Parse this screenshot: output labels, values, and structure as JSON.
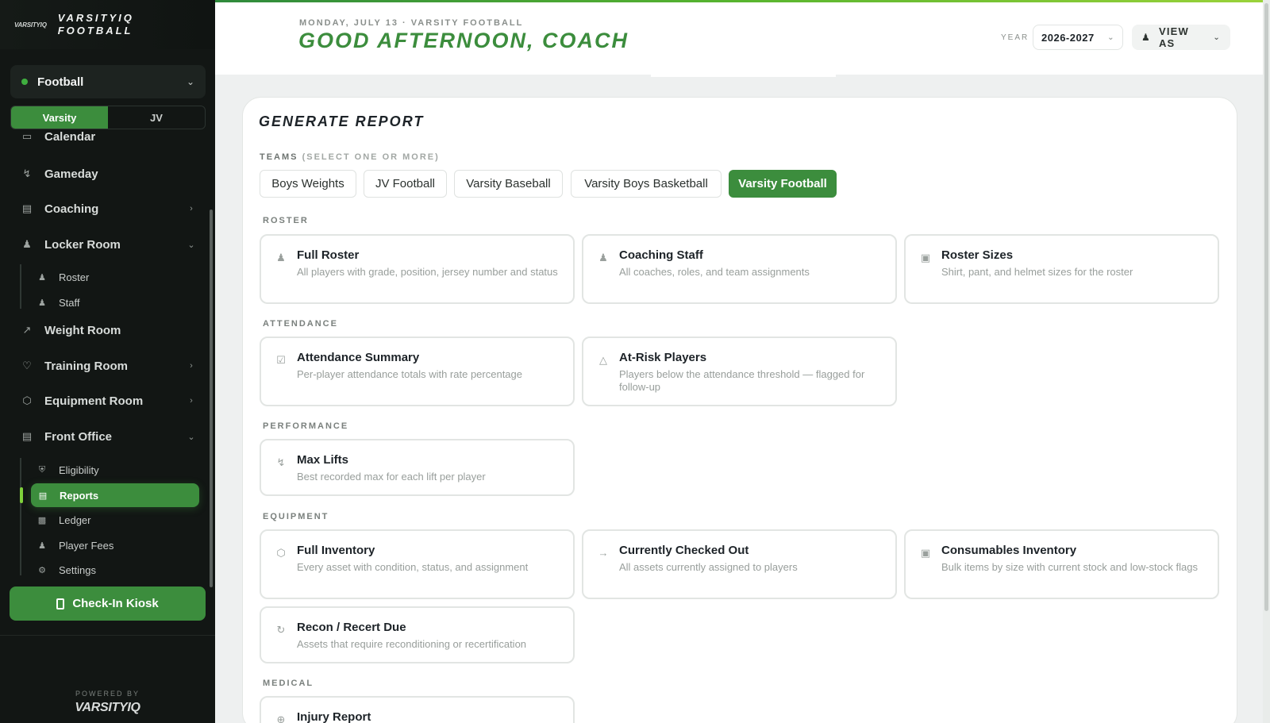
{
  "sidebar": {
    "mini_logo": "VARSITYIQ",
    "team_name": "VARSITYIQ FOOTBALL",
    "sport_select": {
      "label": "Football",
      "status_color": "#3fae3f"
    },
    "levels": [
      "Varsity",
      "JV"
    ],
    "nav": [
      {
        "label": "Calendar",
        "icon": "calendar-icon"
      },
      {
        "label": "Gameday",
        "icon": "bolt-icon"
      },
      {
        "label": "Coaching",
        "icon": "document-icon"
      },
      {
        "label": "Locker Room",
        "icon": "people-icon"
      },
      {
        "label": "Weight Room",
        "icon": "trend-up-icon"
      },
      {
        "label": "Training Room",
        "icon": "heart-icon"
      },
      {
        "label": "Equipment Room",
        "icon": "box-icon"
      },
      {
        "label": "Front Office",
        "icon": "document-icon"
      }
    ],
    "locker_room_sub": [
      {
        "label": "Roster",
        "icon": "people-icon"
      },
      {
        "label": "Staff",
        "icon": "person-icon"
      }
    ],
    "front_office_sub": [
      {
        "label": "Eligibility",
        "icon": "shield-check-icon"
      },
      {
        "label": "Reports",
        "icon": "document-icon"
      },
      {
        "label": "Ledger",
        "icon": "bar-chart-icon"
      },
      {
        "label": "Player Fees",
        "icon": "people-icon"
      },
      {
        "label": "Settings",
        "icon": "gear-icon"
      }
    ],
    "kiosk_label": "Check-In Kiosk",
    "powered_by": "POWERED BY",
    "powered_logo": "VARSITYIQ"
  },
  "header": {
    "eyebrow": "MONDAY, JULY 13 · VARSITY FOOTBALL",
    "greeting": "GOOD AFTERNOON, COACH",
    "year_label": "YEAR",
    "year_value": "2026-2027",
    "view_as": "VIEW AS"
  },
  "report": {
    "title": "GENERATE REPORT",
    "teams_label": "TEAMS",
    "teams_hint": "(SELECT ONE OR MORE)",
    "teams": [
      {
        "label": "Boys Weights",
        "selected": false
      },
      {
        "label": "JV Football",
        "selected": false
      },
      {
        "label": "Varsity Baseball",
        "selected": false
      },
      {
        "label": "Varsity Boys Basketball",
        "selected": false
      },
      {
        "label": "Varsity Football",
        "selected": true
      }
    ],
    "sections": {
      "roster": {
        "label": "ROSTER",
        "cards": [
          {
            "title": "Full Roster",
            "desc": "All players with grade, position, jersey number and status",
            "icon": "people-icon"
          },
          {
            "title": "Coaching Staff",
            "desc": "All coaches, roles, and team assignments",
            "icon": "staff-icon"
          },
          {
            "title": "Roster Sizes",
            "desc": "Shirt, pant, and helmet sizes for the roster",
            "icon": "clipboard-icon"
          }
        ]
      },
      "attendance": {
        "label": "ATTENDANCE",
        "cards": [
          {
            "title": "Attendance Summary",
            "desc": "Per-player attendance totals with rate percentage",
            "icon": "clipboard-check-icon"
          },
          {
            "title": "At-Risk Players",
            "desc": "Players below the attendance threshold — flagged for follow-up",
            "icon": "warning-icon"
          }
        ]
      },
      "performance": {
        "label": "PERFORMANCE",
        "cards": [
          {
            "title": "Max Lifts",
            "desc": "Best recorded max for each lift per player",
            "icon": "bolt-icon"
          }
        ]
      },
      "equipment": {
        "label": "EQUIPMENT",
        "cards": [
          {
            "title": "Full Inventory",
            "desc": "Every asset with condition, status, and assignment",
            "icon": "box-icon"
          },
          {
            "title": "Currently Checked Out",
            "desc": "All assets currently assigned to players",
            "icon": "arrow-right-icon"
          },
          {
            "title": "Consumables Inventory",
            "desc": "Bulk items by size with current stock and low-stock flags",
            "icon": "bag-icon"
          },
          {
            "title": "Recon / Recert Due",
            "desc": "Assets that require reconditioning or recertification",
            "icon": "refresh-icon"
          }
        ]
      },
      "medical": {
        "label": "MEDICAL",
        "cards": [
          {
            "title": "Injury Report",
            "desc": "",
            "icon": "plus-circle-icon"
          }
        ]
      }
    }
  },
  "colors": {
    "brand_green": "#3c8d3d",
    "accent_lime": "#7fd13b",
    "sidebar_bg": "#121614"
  }
}
